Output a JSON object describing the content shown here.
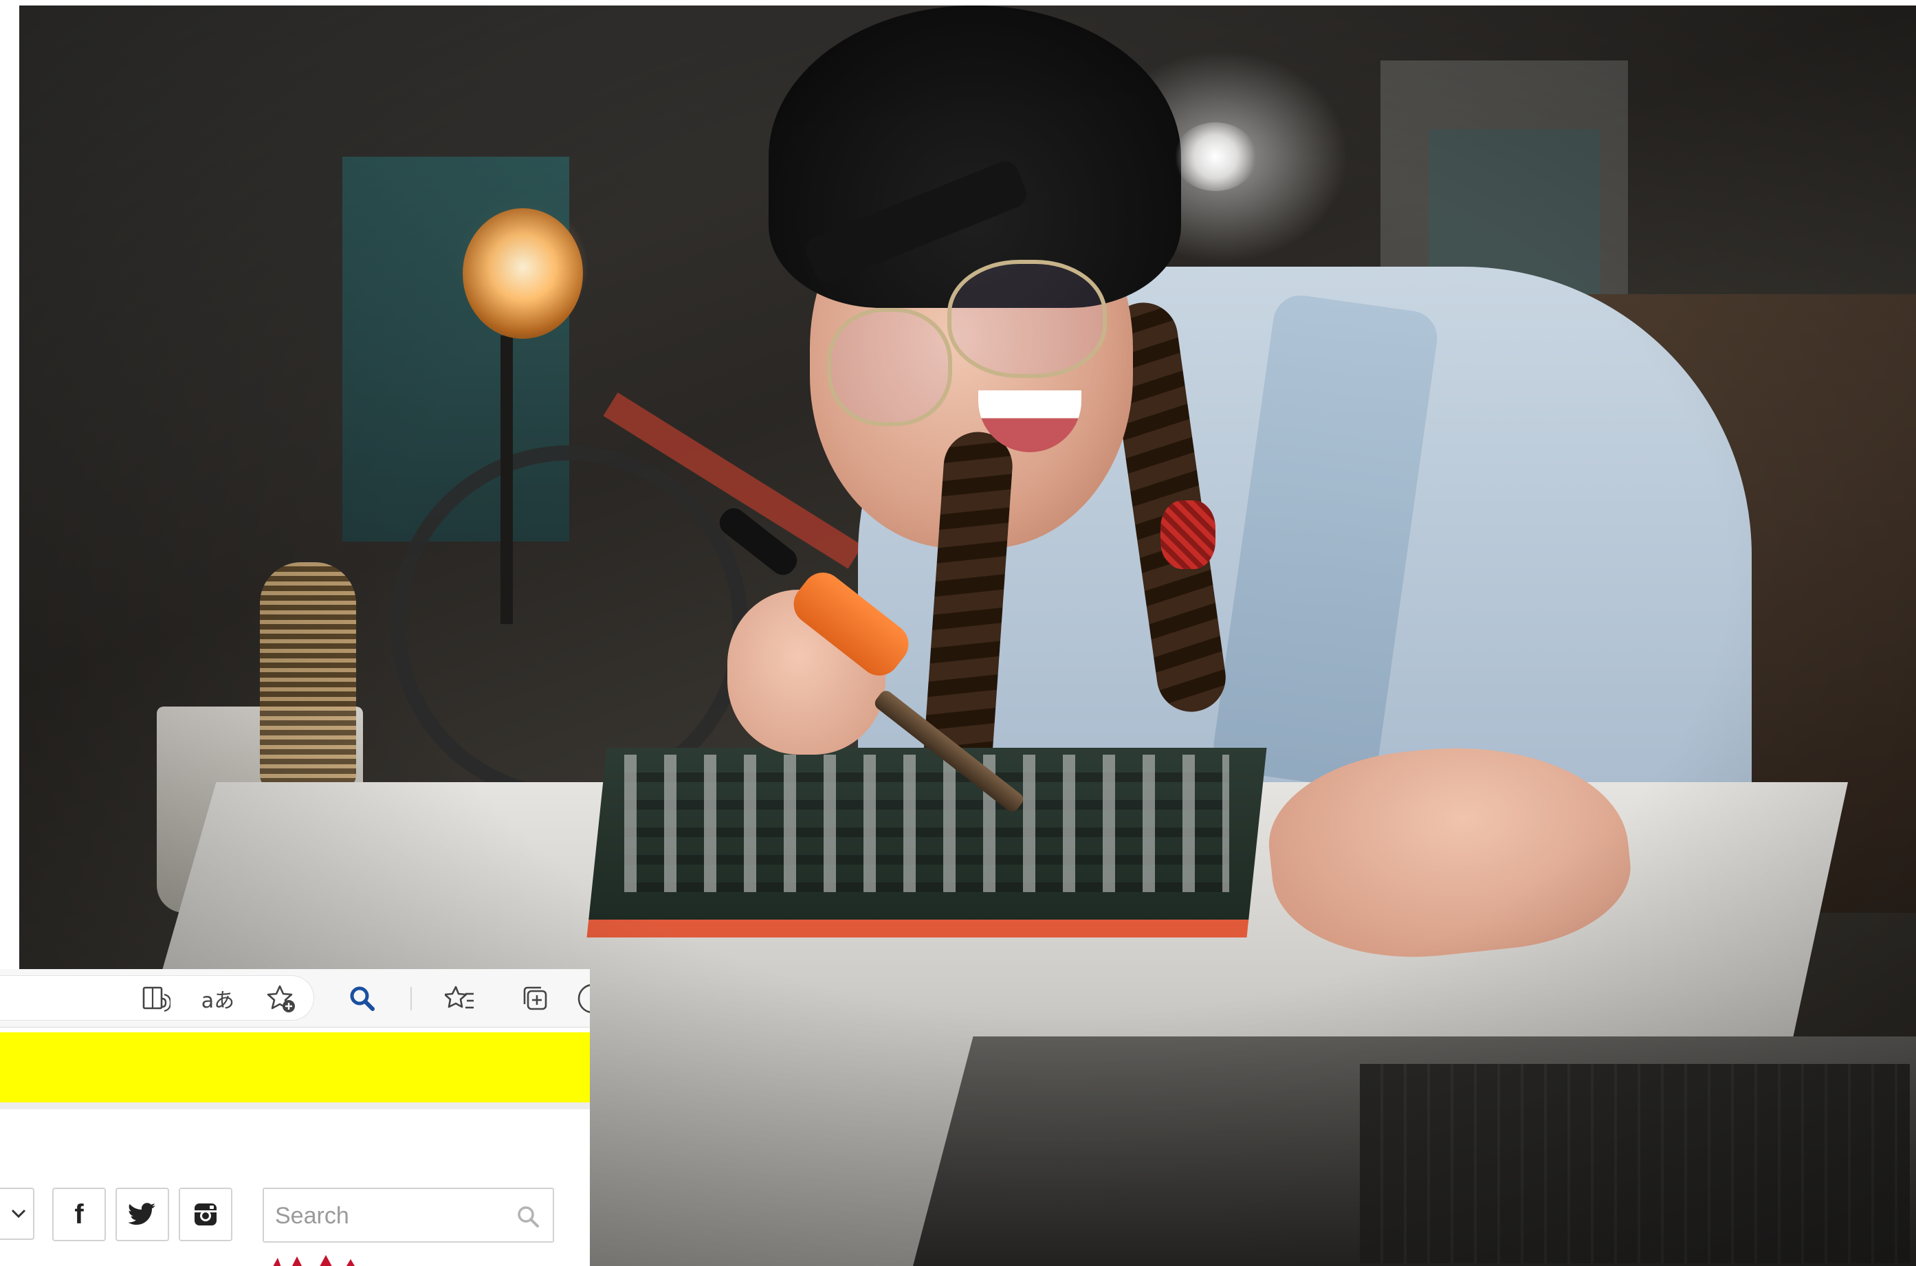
{
  "background_photo": {
    "subject": "woman-soldering-circuit-board"
  },
  "browser_toolbar": {
    "icons": [
      "read-aloud-icon",
      "translate-icon",
      "add-favorite-icon",
      "search-icon",
      "favorites-icon",
      "collections-icon"
    ],
    "translate_glyph": "aあ",
    "accent_color": "#1a4fa0"
  },
  "banner": {
    "color": "#ffff00"
  },
  "social": {
    "icons": [
      "facebook-icon",
      "twitter-icon",
      "instagram-icon"
    ],
    "facebook_glyph": "f"
  },
  "search": {
    "placeholder": "Search",
    "value": ""
  },
  "logo": {
    "color": "#c4122f"
  }
}
